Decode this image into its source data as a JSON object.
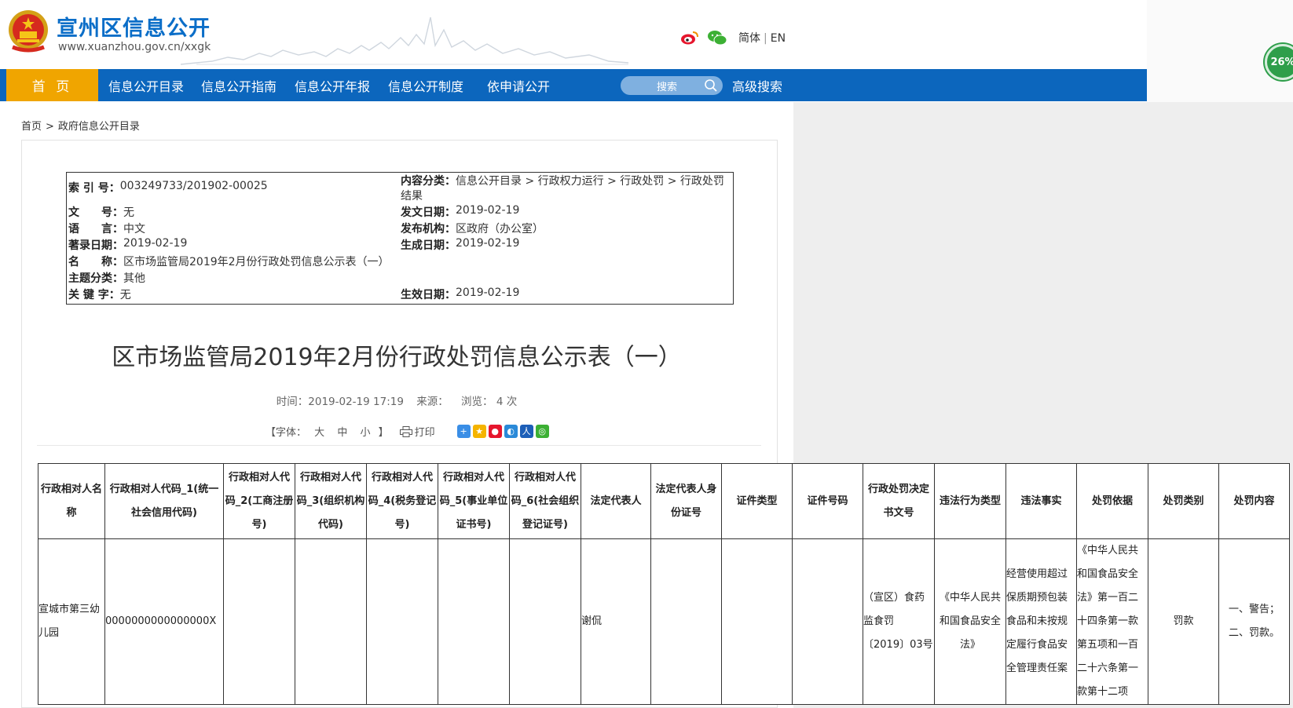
{
  "header": {
    "site_title": "宣州区信息公开",
    "site_url": "www.xuanzhou.gov.cn/xxgk",
    "lang_simplified": "简体",
    "lang_sep": "|",
    "lang_en": "EN"
  },
  "nav": {
    "home": "首 页",
    "items": [
      "信息公开目录",
      "信息公开指南",
      "信息公开年报",
      "信息公开制度",
      "依申请公开"
    ],
    "search_label": "搜索",
    "advanced_search": "高级搜索"
  },
  "zoom": "26%",
  "breadcrumb": [
    "首页",
    "政府信息公开目录"
  ],
  "breadcrumb_sep": ">",
  "meta": {
    "index_label": "索 引 号：",
    "index_value": "003249733/201902-00025",
    "category_label": "内容分类：",
    "category_value": "信息公开目录 > 行政权力运行 > 行政处罚 > 行政处罚",
    "category_value_2": "结果",
    "docno_label": "文　　号：",
    "docno_value": "无",
    "issue_date_label": "发文日期：",
    "issue_date_value": "2019-02-19",
    "language_label": "语　　言：",
    "language_value": "中文",
    "publisher_label": "发布机构：",
    "publisher_value": "区政府（办公室）",
    "record_date_label": "著录日期：",
    "record_date_value": "2019-02-19",
    "gen_date_label": "生成日期：",
    "gen_date_value": "2019-02-19",
    "name_label": "名　　称：",
    "name_value": "区市场监管局2019年2月份行政处罚信息公示表（一）",
    "topic_label": "主题分类：",
    "topic_value": "其他",
    "keyword_label": "关 键 字：",
    "keyword_value": "无",
    "effective_date_label": "生效日期：",
    "effective_date_value": "2019-02-19"
  },
  "doc": {
    "title": "区市场监管局2019年2月份行政处罚信息公示表（一）",
    "time": "时间：2019-02-19 17:19",
    "source": "来源：",
    "views": "浏览： 4 次"
  },
  "tools": {
    "font_open": "【字体：",
    "font_large": "大",
    "font_medium": "中",
    "font_small": "小",
    "font_close": "】",
    "print": "打印"
  },
  "table": {
    "headers": [
      "行政相对人名称",
      "行政相对人代码_1(统一社会信用代码)",
      "行政相对人代码_2(工商注册号)",
      "行政相对人代码_3(组织机构代码)",
      "行政相对人代码_4(税务登记号)",
      "行政相对人代码_5(事业单位证书号)",
      "行政相对人代码_6(社会组织登记证号)",
      "法定代表人",
      "法定代表人身份证号",
      "证件类型",
      "证件号码",
      "行政处罚决定书文号",
      "违法行为类型",
      "违法事实",
      "处罚依据",
      "处罚类别",
      "处罚内容"
    ],
    "row": [
      "宣城市第三幼儿园",
      "0000000000000000X",
      "",
      "",
      "",
      "",
      "",
      "谢侃",
      "",
      "",
      "",
      "（宣区）食药监食罚〔2019〕03号",
      "《中华人民共和国食品安全法》",
      "经营使用超过保质期预包装食品和未按规定履行食品安全管理责任案",
      "《中华人民共和国食品安全法》第一百二十四条第一款第五项和一百二十六条第一款第十二项",
      "罚款",
      "一、警告；二、罚款。"
    ]
  }
}
